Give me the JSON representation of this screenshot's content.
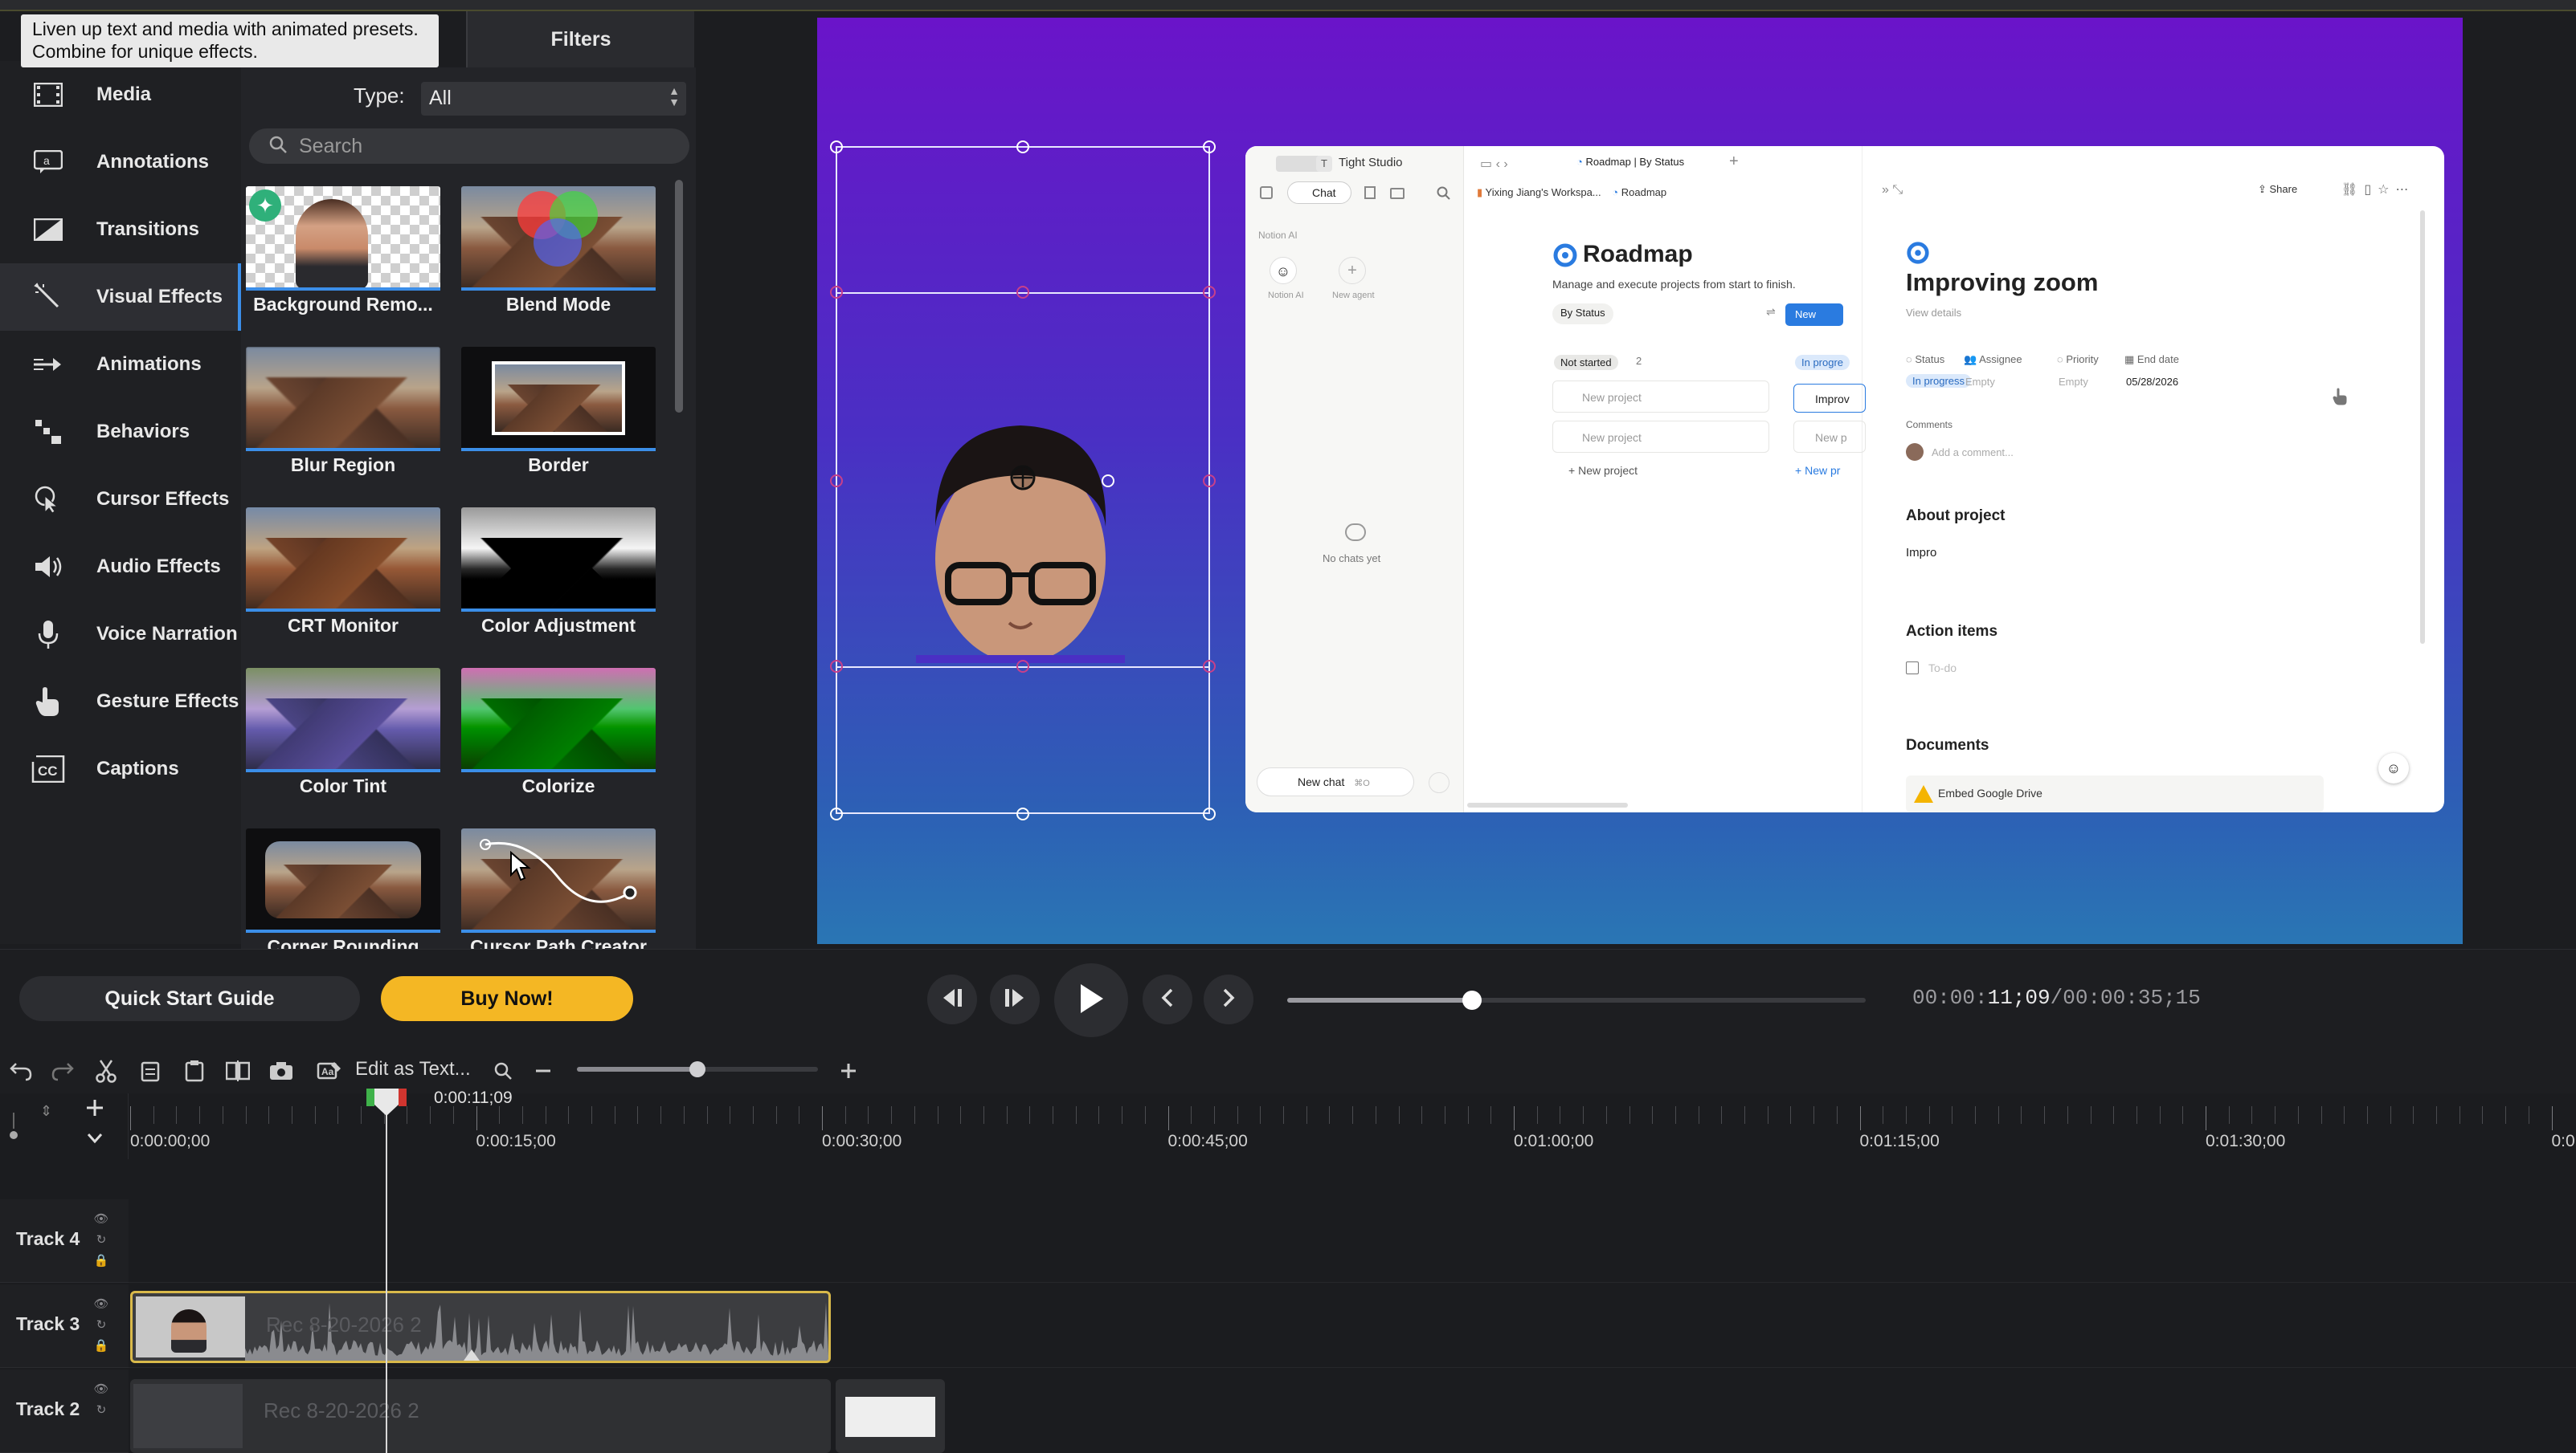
{
  "tooltip": {
    "text": "Liven up text and media with animated presets. Combine for unique effects."
  },
  "filters_tab": "Filters",
  "sidebar": {
    "items": [
      {
        "label": "Media",
        "icon": "film-icon"
      },
      {
        "label": "Annotations",
        "icon": "annotation-icon"
      },
      {
        "label": "Transitions",
        "icon": "transition-icon"
      },
      {
        "label": "Visual Effects",
        "icon": "magic-wand-icon",
        "active": true
      },
      {
        "label": "Animations",
        "icon": "animation-arrow-icon"
      },
      {
        "label": "Behaviors",
        "icon": "behaviors-icon"
      },
      {
        "label": "Cursor Effects",
        "icon": "cursor-icon"
      },
      {
        "label": "Audio Effects",
        "icon": "speaker-icon"
      },
      {
        "label": "Voice Narration",
        "icon": "microphone-icon"
      },
      {
        "label": "Gesture Effects",
        "icon": "hand-icon"
      },
      {
        "label": "Captions",
        "icon": "cc-icon"
      }
    ]
  },
  "effects_panel": {
    "type_label": "Type:",
    "type_value": "All",
    "search_placeholder": "Search",
    "tiles": [
      {
        "label": "Background Remo..."
      },
      {
        "label": "Blend Mode"
      },
      {
        "label": "Blur Region"
      },
      {
        "label": "Border"
      },
      {
        "label": "CRT Monitor"
      },
      {
        "label": "Color Adjustment"
      },
      {
        "label": "Color Tint"
      },
      {
        "label": "Colorize"
      },
      {
        "label": "Corner Rounding"
      },
      {
        "label": "Cursor Path Creator"
      }
    ]
  },
  "notion": {
    "workspace": "Tight Studio",
    "workspace_badge": "T",
    "tab_title": "Roadmap | By Status",
    "chat_tab": "Chat",
    "notion_ai_label": "Notion AI",
    "agent_notion_ai": "Notion AI",
    "agent_new": "New agent",
    "no_chats": "No chats yet",
    "new_chat": "New chat",
    "new_chat_shortcut": "⌘O",
    "breadcrumb_workspace": "Yixing Jiang's Workspa...",
    "breadcrumb_page": "Roadmap",
    "roadmap_title": "Roadmap",
    "roadmap_desc": "Manage and execute projects from start to finish.",
    "view_by_status": "By Status",
    "new_button": "New",
    "col_not_started": "Not started",
    "col_not_started_count": "2",
    "col_in_progress": "In progre",
    "new_project_1": "New project",
    "new_project_2": "New project",
    "new_project_add": "New project",
    "in_progress_card": "Improv",
    "in_progress_card2": "New p",
    "in_progress_add": "New pr",
    "share": "Share",
    "detail_title": "Improving zoom",
    "view_details": "View details",
    "prop_status": "Status",
    "prop_assignee": "Assignee",
    "prop_priority": "Priority",
    "prop_end_date": "End date",
    "val_status": "In progress",
    "val_assignee": "Empty",
    "val_priority": "Empty",
    "val_end_date": "05/28/2026",
    "comments": "Comments",
    "add_comment": "Add a comment...",
    "about_project": "About project",
    "about_text": "Impro",
    "action_items": "Action items",
    "todo": "To-do",
    "documents": "Documents",
    "embed_drive": "Embed Google Drive"
  },
  "controls": {
    "quick_start": "Quick Start Guide",
    "buy_now": "Buy Now!",
    "timecode_prefix": "00:00:",
    "timecode_current": "11;09",
    "timecode_total": "/00:00:35;15",
    "scrub_progress": 0.32
  },
  "timeline_toolbar": {
    "edit_as_text": "Edit as Text...",
    "zoom_level": 0.5
  },
  "ruler": {
    "playhead_time": "0:00:11;09",
    "labels": [
      "0:00:00;00",
      "0:00:15;00",
      "0:00:30;00",
      "0:00:45;00",
      "0:01:00;00",
      "0:01:15;00",
      "0:01:30;00",
      "0:0"
    ]
  },
  "tracks": [
    {
      "name": "Track 4"
    },
    {
      "name": "Track 3",
      "clip": "Rec 8-20-2026 2"
    },
    {
      "name": "Track 2",
      "clip": "Rec 8-20-2026 2"
    }
  ],
  "colors": {
    "accent_blue": "#3b8ee8",
    "buy_yellow": "#f4b724",
    "clip_border": "#d9b94a",
    "canvas_top": "#6a14c9",
    "canvas_bottom": "#2a76b4"
  }
}
